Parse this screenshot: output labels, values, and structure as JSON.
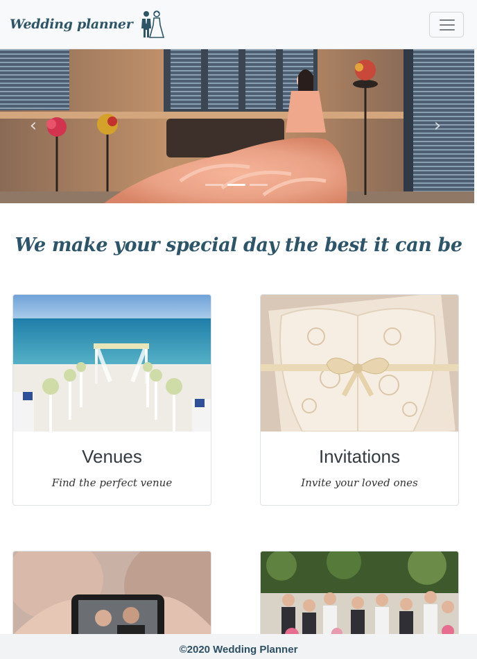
{
  "navbar": {
    "brand": "Wedding planner",
    "brand_icon": "bride-groom-icon",
    "toggler_icon": "hamburger-menu-icon"
  },
  "carousel": {
    "prev_icon": "chevron-left-icon",
    "next_icon": "chevron-right-icon",
    "prev_glyph": "‹",
    "next_glyph": "›",
    "active_slide": 2,
    "slide_count": 3
  },
  "tagline": "We make your special day the best it can be",
  "cards": [
    {
      "title": "Venues",
      "subtitle": "Find the perfect venue"
    },
    {
      "title": "Invitations",
      "subtitle": "Invite your loved ones"
    },
    {
      "title": "",
      "subtitle": ""
    },
    {
      "title": "",
      "subtitle": ""
    }
  ],
  "footer": {
    "copyright": "©2020 Wedding Planner"
  },
  "colors": {
    "brand": "#2e5566",
    "tagline": "#2d5569",
    "navbar_bg": "#f8f9fa",
    "footer_bg": "#f1f3f5"
  }
}
